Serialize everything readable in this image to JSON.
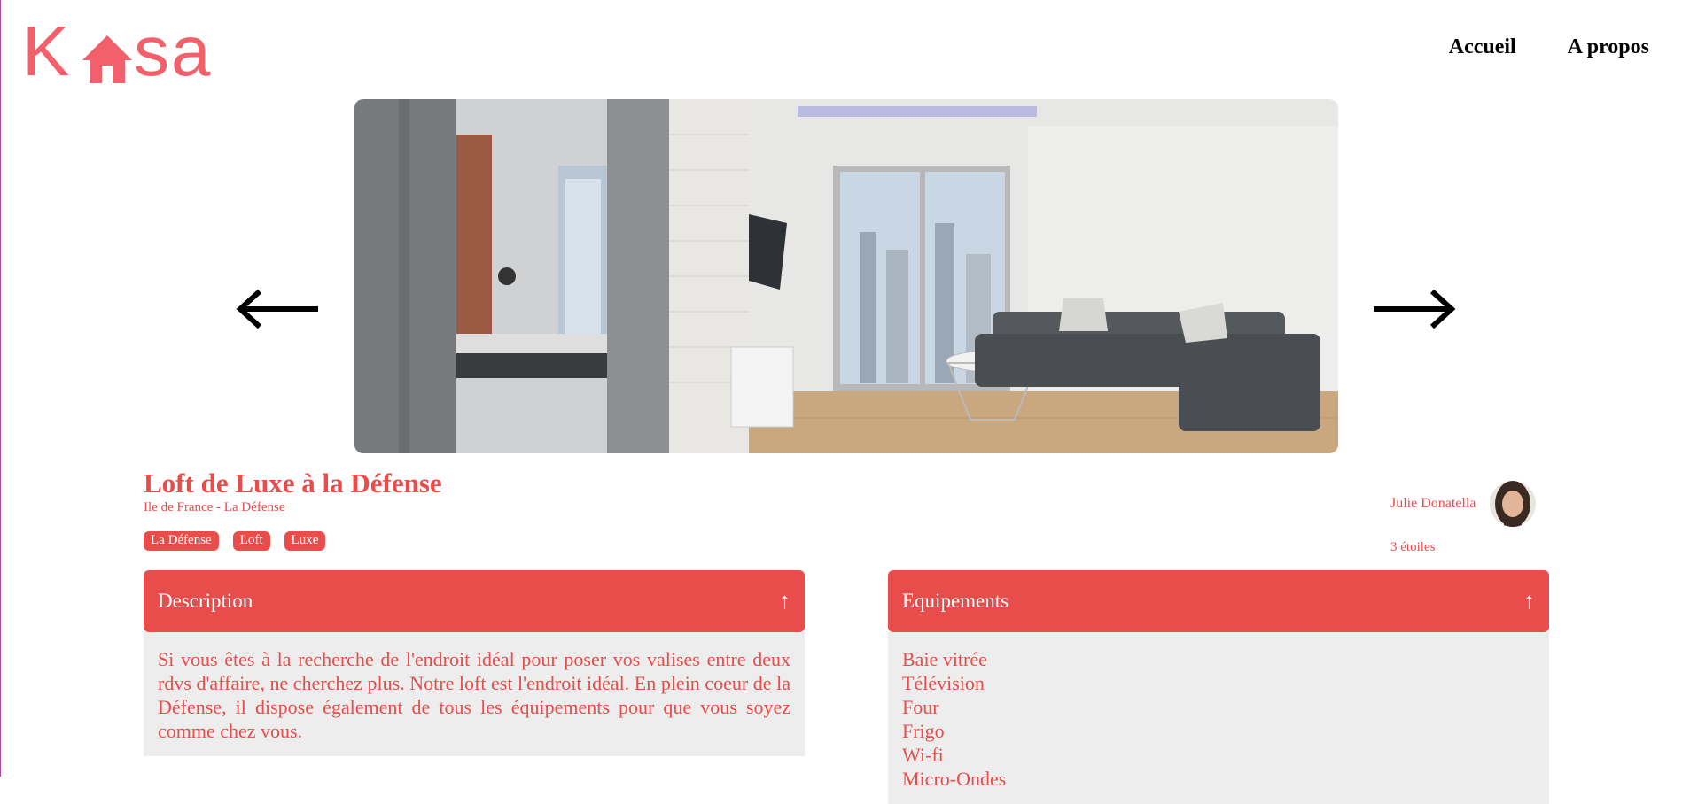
{
  "brand": {
    "logo_text": "Kasa",
    "logo_left": "K",
    "logo_right": "sa",
    "color": "#f2606b"
  },
  "nav": {
    "home": "Accueil",
    "about": "A propos"
  },
  "listing": {
    "title": "Loft de Luxe à la Défense",
    "location": "Ile de France - La Défense",
    "tags": [
      "La Défense",
      "Loft",
      "Luxe"
    ],
    "host_name": "Julie Donatella",
    "rating_text": "3 étoiles"
  },
  "description": {
    "label": "Description",
    "text": "Si vous êtes à la recherche de l'endroit idéal pour poser vos valises entre deux rdvs d'affaire, ne cherchez plus. Notre loft est l'endroit idéal. En plein coeur de la Défense, il dispose également de tous les équipements pour que vous soyez comme chez vous."
  },
  "equipments": {
    "label": "Equipements",
    "items": [
      "Baie vitrée",
      "Télévision",
      "Four",
      "Frigo",
      "Wi-fi",
      "Micro-Ondes"
    ]
  },
  "icons": {
    "prev": "arrow-left-icon",
    "next": "arrow-right-icon",
    "collapse": "chevron-up-icon",
    "chevron_glyph": "↑"
  },
  "colors": {
    "accent": "#e84d4b",
    "panel_bg": "#ededed"
  }
}
